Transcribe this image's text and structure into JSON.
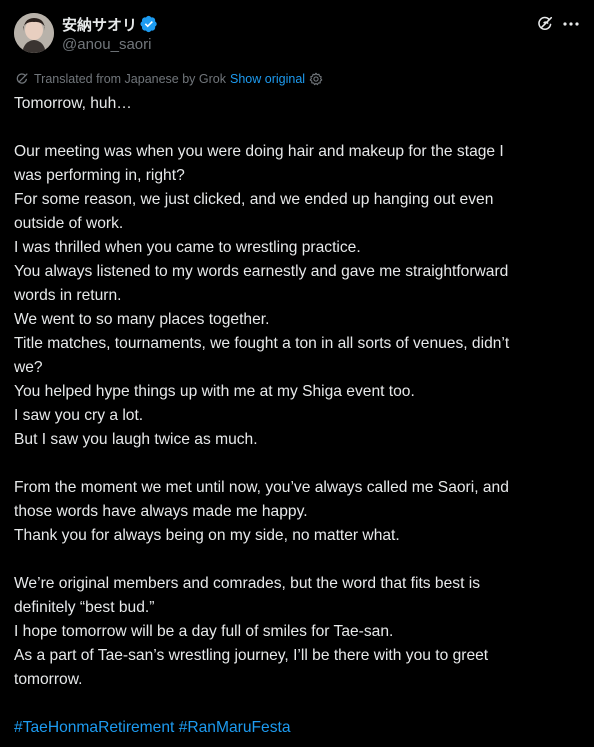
{
  "author": {
    "display_name": "安納サオリ",
    "handle": "@anou_saori",
    "verified": true
  },
  "header_icons": {
    "grok": "grok-icon",
    "more": "more-icon"
  },
  "translation": {
    "label": "Translated from Japanese by Grok",
    "show_original": "Show original"
  },
  "tweet": {
    "lines": [
      "Tomorrow, huh…",
      "",
      "Our meeting was when you were doing hair and makeup for the stage I",
      "was performing in, right?",
      "For some reason, we just clicked, and we ended up hanging out even",
      "outside of work.",
      "I was thrilled when you came to wrestling practice.",
      "You always listened to my words earnestly and gave me straightforward",
      "words in return.",
      "We went to so many places together.",
      "Title matches, tournaments, we fought a ton in all sorts of venues, didn’t",
      "we?",
      "You helped hype things up with me at my Shiga event too.",
      "I saw you cry a lot.",
      "But I saw you laugh twice as much.",
      "",
      "From the moment we met until now, you’ve always called me Saori, and",
      "those words have always made me happy.",
      "Thank you for always being on my side, no matter what.",
      "",
      "We’re original members and comrades, but the word that fits best is",
      "definitely “best bud.”",
      "I hope tomorrow will be a day full of smiles for Tae-san.",
      "As a part of Tae-san’s wrestling journey, I’ll be there with you to greet",
      "tomorrow."
    ],
    "hashtags": [
      "#TaeHonmaRetirement",
      "#RanMaruFesta"
    ]
  },
  "colors": {
    "background": "#000000",
    "text": "#e7e9ea",
    "secondary": "#71767b",
    "accent": "#1d9bf0"
  }
}
